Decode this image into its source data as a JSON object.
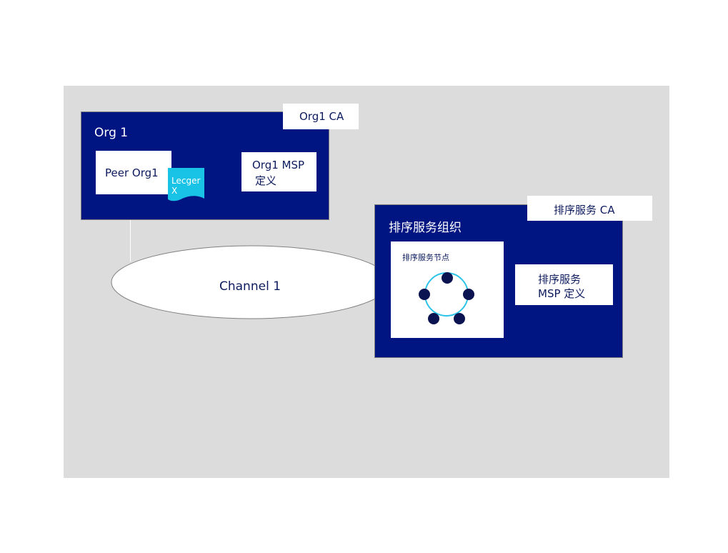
{
  "org1": {
    "title": "Org 1",
    "ca_label": "Org1 CA",
    "peer_label": "Peer Org1",
    "ledger_line1": "Lecger",
    "ledger_line2": "X",
    "msp_line1": "Org1 MSP",
    "msp_line2": "定义"
  },
  "channel": {
    "label": "Channel 1"
  },
  "orderer": {
    "title": "排序服务组织",
    "ca_label": "排序服务 CA",
    "nodes_label": "排序服务节点",
    "msp_line1": "排序服务",
    "msp_line2": "MSP 定义"
  },
  "colors": {
    "org_fill": "#001482",
    "ledger_fill": "#18c3e6",
    "ring_stroke": "#2ec4e8",
    "node_fill": "#0b1450",
    "canvas_bg": "#dcdcdc"
  }
}
